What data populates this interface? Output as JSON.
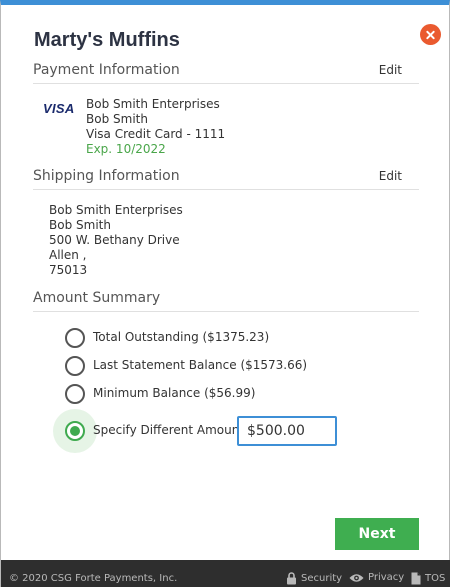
{
  "header": {
    "title": "Marty's Muffins"
  },
  "payment": {
    "section_label": "Payment Information",
    "edit_label": "Edit",
    "card_brand": "VISA",
    "company": "Bob Smith Enterprises",
    "name": "Bob Smith",
    "card_desc": "Visa Credit Card - 1111",
    "expiry": "Exp. 10/2022"
  },
  "shipping": {
    "section_label": "Shipping Information",
    "edit_label": "Edit",
    "company": "Bob Smith Enterprises",
    "name": "Bob Smith",
    "street": "500 W. Bethany Drive",
    "city": "Allen ,",
    "zip": "75013"
  },
  "amount": {
    "section_label": "Amount Summary",
    "options": [
      {
        "label": "Total Outstanding ($1375.23)",
        "selected": false
      },
      {
        "label": "Last Statement Balance ($1573.66)",
        "selected": false
      },
      {
        "label": "Minimum Balance ($56.99)",
        "selected": false
      },
      {
        "label": "Specify Different Amount",
        "selected": true
      }
    ],
    "custom_value": "$500.00"
  },
  "actions": {
    "next_label": "Next"
  },
  "footer": {
    "copyright": "© 2020 CSG Forte Payments, Inc.",
    "security": "Security",
    "privacy": "Privacy",
    "tos": "TOS"
  },
  "colors": {
    "accent_blue": "#3d8fd6",
    "success_green": "#3fae50",
    "close_orange": "#ea5a2f",
    "footer_bg": "#2e2e2e"
  }
}
